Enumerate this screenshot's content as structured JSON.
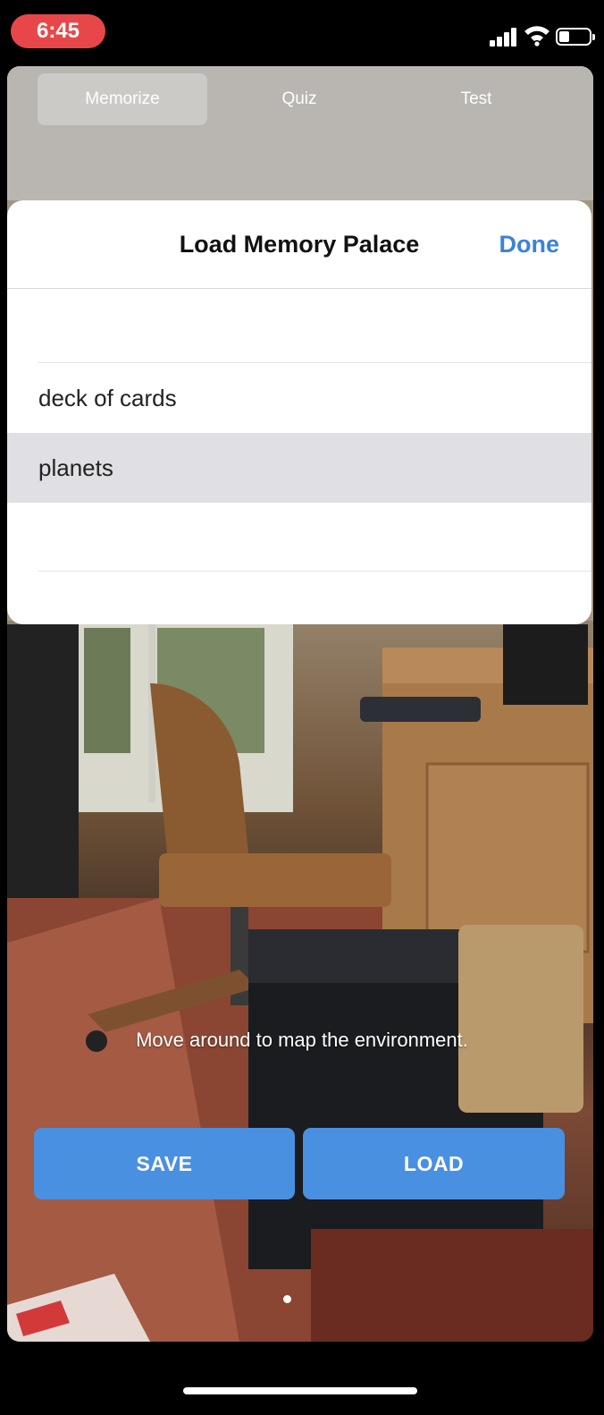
{
  "status_bar": {
    "time": "6:45",
    "signal_icon": "cellular-signal-icon",
    "wifi_icon": "wifi-icon",
    "battery_icon": "battery-icon",
    "battery_level": 0.2,
    "time_pill_color": "#e8474a"
  },
  "tabs": [
    {
      "label": "Memorize",
      "active": true
    },
    {
      "label": "Quiz",
      "active": false
    },
    {
      "label": "Test",
      "active": false
    }
  ],
  "sheet": {
    "title": "Load Memory Palace",
    "done_label": "Done",
    "items": [
      {
        "label": "",
        "selected": false
      },
      {
        "label": "deck of cards",
        "selected": false
      },
      {
        "label": "planets",
        "selected": true
      },
      {
        "label": "",
        "selected": false
      }
    ]
  },
  "hint": "Move around to map the environment.",
  "buttons": {
    "save_label": "SAVE",
    "load_label": "LOAD"
  },
  "colors": {
    "accent": "#4a90e0",
    "done_text": "#3b82d9",
    "selected_row": "#dfdfe4"
  }
}
